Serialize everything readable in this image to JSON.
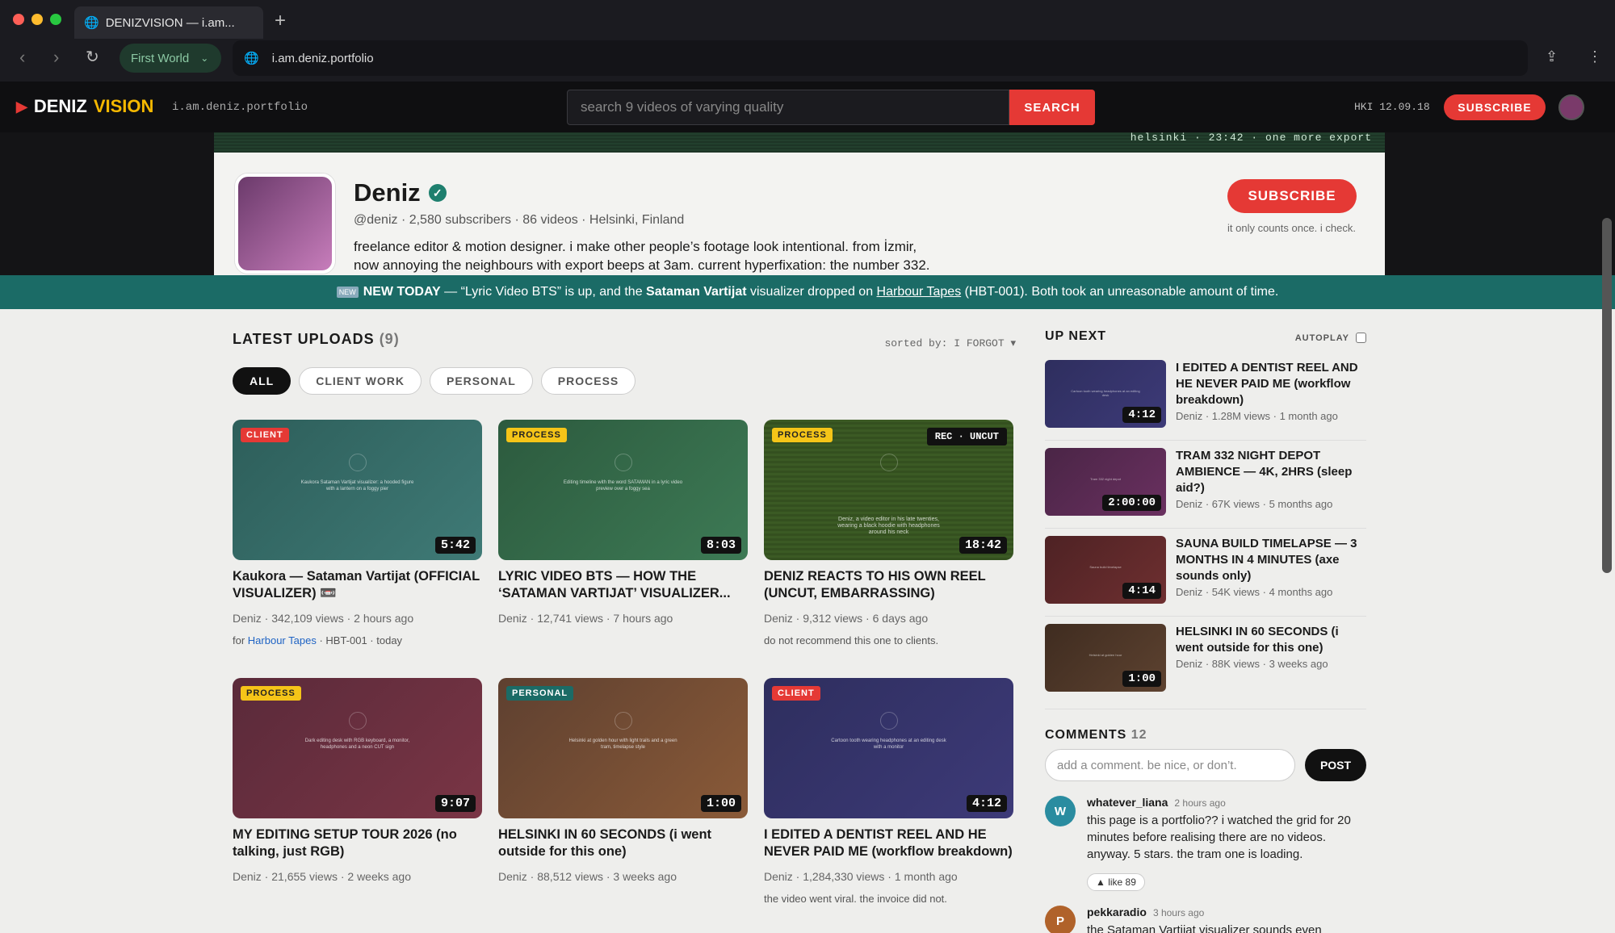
{
  "browser": {
    "tab_title": "DENIZVISION — i.am...",
    "profile": "First World",
    "url": "i.am.deniz.portfolio"
  },
  "site": {
    "logo_deniz": "DENIZ",
    "logo_vision": "VISION",
    "domain": "i.am.deniz.portfolio",
    "search_placeholder": "search 9 videos of varying quality",
    "search_btn": "SEARCH",
    "location_date": "HKI 12.09.18",
    "subscribe": "SUBSCRIBE",
    "ticker": "helsinki · 23:42 · one more export"
  },
  "channel": {
    "name": "Deniz",
    "meta": "@deniz · 2,580 subscribers · 86 videos · Helsinki, Finland",
    "bio1": "freelance editor & motion designer. i make other people’s footage look intentional. from İzmir,",
    "bio2": "now annoying the neighbours with export beeps at 3am. current hyperfixation: the number 332.",
    "subscribe": "SUBSCRIBE",
    "subscribe_note": "it only counts once. i check."
  },
  "banner": {
    "icon": "NEW",
    "lead": "NEW TODAY",
    "text1": " — “Lyric Video BTS” is up, and the ",
    "bold": "Sataman Vartijat",
    "text2": " visualizer dropped on ",
    "link": "Harbour Tapes",
    "text3": " (HBT-001). Both took an unreasonable amount of time."
  },
  "uploads": {
    "title": "LATEST UPLOADS",
    "count": "(9)",
    "sorted": "sorted by: I FORGOT ▾",
    "chips": [
      "ALL",
      "CLIENT WORK",
      "PERSONAL",
      "PROCESS"
    ],
    "videos": [
      {
        "badge": "CLIENT",
        "duration": "5:42",
        "title": "Kaukora — Sataman Vartijat (OFFICIAL VISUALIZER) 📼",
        "meta": "Deniz · 342,109 views · 2 hours ago",
        "note_pre": "for ",
        "note_link": "Harbour Tapes",
        "note_post": " · HBT-001 · today",
        "caption": "Kaukora Sataman Vartijat visualizer: a hooded figure with a lantern on a foggy pier"
      },
      {
        "badge": "PROCESS",
        "duration": "8:03",
        "title": "LYRIC VIDEO BTS — HOW THE ‘SATAMAN VARTIJAT’ VISUALIZER...",
        "meta": "Deniz · 12,741 views · 7 hours ago",
        "caption": "Editing timeline with the word SATAMAN in a lyric video preview over a foggy sea"
      },
      {
        "badge": "PROCESS",
        "duration": "18:42",
        "rec": "REC · UNCUT",
        "title": "DENIZ REACTS TO HIS OWN REEL (UNCUT, EMBARRASSING)",
        "meta": "Deniz · 9,312 views · 6 days ago",
        "note": "do not recommend this one to clients.",
        "caption": "Deniz, a video editor in his late twenties, wearing a black hoodie with headphones around his neck"
      },
      {
        "badge": "PROCESS",
        "duration": "9:07",
        "title": "MY EDITING SETUP TOUR 2026 (no talking, just RGB)",
        "meta": "Deniz · 21,655 views · 2 weeks ago",
        "caption": "Dark editing desk with RGB keyboard, a monitor, headphones and a neon CUT sign"
      },
      {
        "badge": "PERSONAL",
        "duration": "1:00",
        "title": "HELSINKI IN 60 SECONDS (i went outside for this one)",
        "meta": "Deniz · 88,512 views · 3 weeks ago",
        "caption": "Helsinki at golden hour with light trails and a green tram, timelapse style"
      },
      {
        "badge": "CLIENT",
        "duration": "4:12",
        "title": "I EDITED A DENTIST REEL AND HE NEVER PAID ME (workflow breakdown)",
        "meta": "Deniz · 1,284,330 views · 1 month ago",
        "note": "the video went viral. the invoice did not.",
        "caption": "Cartoon tooth wearing headphones at an editing desk with a monitor"
      }
    ]
  },
  "upnext": {
    "title": "UP NEXT",
    "autoplay": "AUTOPLAY",
    "items": [
      {
        "title": "I EDITED A DENTIST REEL AND HE NEVER PAID ME (workflow breakdown)",
        "meta": "Deniz · 1.28M views · 1 month ago",
        "duration": "4:12",
        "caption": "Cartoon tooth wearing headphones at an editing desk"
      },
      {
        "title": "TRAM 332 NIGHT DEPOT AMBIENCE — 4K, 2HRS (sleep aid?)",
        "meta": "Deniz · 67K views · 5 months ago",
        "duration": "2:00:00",
        "caption": "Tram 332 night depot"
      },
      {
        "title": "SAUNA BUILD TIMELAPSE — 3 MONTHS IN 4 MINUTES (axe sounds only)",
        "meta": "Deniz · 54K views · 4 months ago",
        "duration": "4:14",
        "caption": "Sauna build timelapse"
      },
      {
        "title": "HELSINKI IN 60 SECONDS (i went outside for this one)",
        "meta": "Deniz · 88K views · 3 weeks ago",
        "duration": "1:00",
        "caption": "Helsinki at golden hour"
      }
    ]
  },
  "comments": {
    "title": "COMMENTS",
    "count": "12",
    "placeholder": "add a comment. be nice, or don’t.",
    "post": "POST",
    "items": [
      {
        "initial": "W",
        "user": "whatever_liana",
        "time": "2 hours ago",
        "text": "this page is a portfolio?? i watched the grid for 20 minutes before realising there are no videos. anyway. 5 stars. the tram one is loading.",
        "like": "▲ like 89"
      },
      {
        "initial": "P",
        "user": "pekkaradio",
        "time": "3 hours ago",
        "text": "the Sataman Vartijat visualizer sounds even"
      }
    ]
  }
}
